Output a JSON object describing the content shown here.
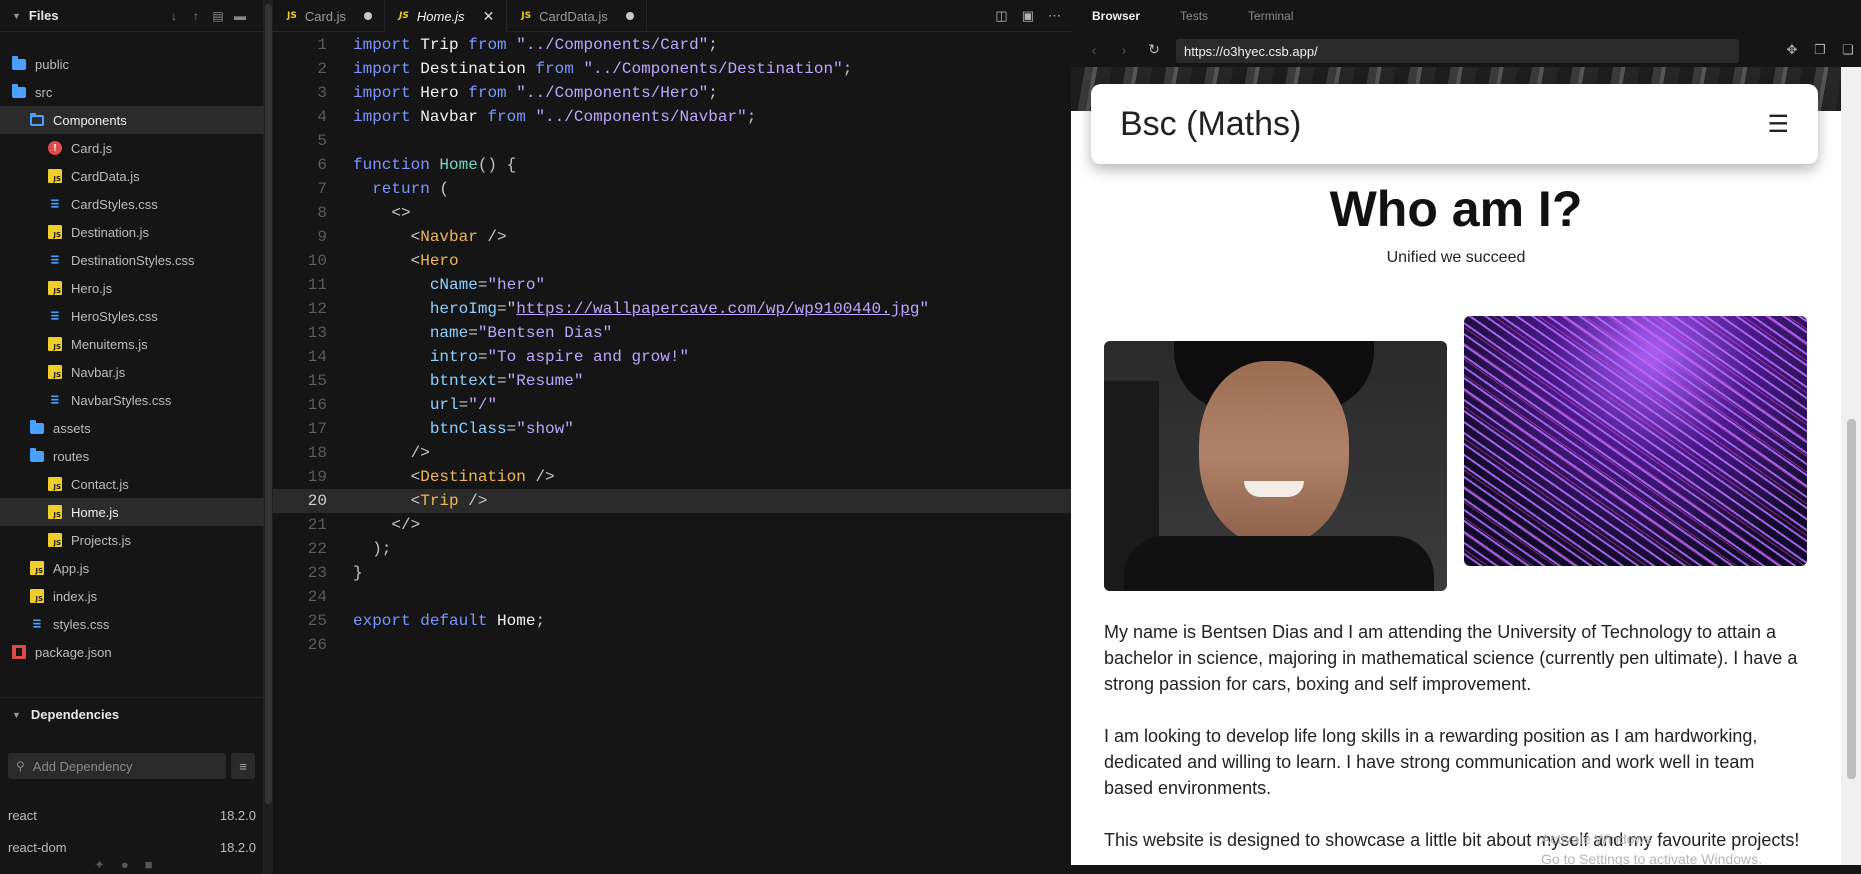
{
  "sidebar": {
    "title": "Files",
    "tree": [
      {
        "label": "public",
        "icon": "folder",
        "depth": 0
      },
      {
        "label": "src",
        "icon": "folder",
        "depth": 0
      },
      {
        "label": "Components",
        "icon": "folder-open",
        "depth": 1,
        "active": true
      },
      {
        "label": "Card.js",
        "icon": "error",
        "depth": 2
      },
      {
        "label": "CardData.js",
        "icon": "js",
        "depth": 2
      },
      {
        "label": "CardStyles.css",
        "icon": "css",
        "depth": 2
      },
      {
        "label": "Destination.js",
        "icon": "js",
        "depth": 2
      },
      {
        "label": "DestinationStyles.css",
        "icon": "css",
        "depth": 2
      },
      {
        "label": "Hero.js",
        "icon": "js",
        "depth": 2
      },
      {
        "label": "HeroStyles.css",
        "icon": "css",
        "depth": 2
      },
      {
        "label": "Menuitems.js",
        "icon": "js",
        "depth": 2
      },
      {
        "label": "Navbar.js",
        "icon": "js",
        "depth": 2
      },
      {
        "label": "NavbarStyles.css",
        "icon": "css",
        "depth": 2
      },
      {
        "label": "assets",
        "icon": "folder",
        "depth": 1
      },
      {
        "label": "routes",
        "icon": "folder",
        "depth": 1
      },
      {
        "label": "Contact.js",
        "icon": "js",
        "depth": 2
      },
      {
        "label": "Home.js",
        "icon": "js",
        "depth": 2,
        "active": true
      },
      {
        "label": "Projects.js",
        "icon": "js",
        "depth": 2
      },
      {
        "label": "App.js",
        "icon": "js",
        "depth": 1
      },
      {
        "label": "index.js",
        "icon": "js",
        "depth": 1
      },
      {
        "label": "styles.css",
        "icon": "css",
        "depth": 1
      },
      {
        "label": "package.json",
        "icon": "package",
        "depth": 0
      }
    ],
    "dependencies": {
      "title": "Dependencies",
      "placeholder": "Add Dependency",
      "items": [
        {
          "name": "react",
          "version": "18.2.0"
        },
        {
          "name": "react-dom",
          "version": "18.2.0"
        }
      ]
    }
  },
  "editor": {
    "tabs": [
      {
        "label": "Card.js",
        "badge": "JS",
        "state": "dot"
      },
      {
        "label": "Home.js",
        "badge": "JS",
        "state": "close",
        "active": true
      },
      {
        "label": "CardData.js",
        "badge": "JS",
        "state": "dot"
      }
    ],
    "current_line": 20,
    "lines": [
      [
        [
          "k",
          "import "
        ],
        [
          "id",
          "Trip "
        ],
        [
          "k",
          "from "
        ],
        [
          "s",
          "\"../Components/Card\""
        ],
        [
          "p",
          ";"
        ]
      ],
      [
        [
          "k",
          "import "
        ],
        [
          "id",
          "Destination "
        ],
        [
          "k",
          "from "
        ],
        [
          "s",
          "\"../Components/Destination\""
        ],
        [
          "p",
          ";"
        ]
      ],
      [
        [
          "k",
          "import "
        ],
        [
          "id",
          "Hero "
        ],
        [
          "k",
          "from "
        ],
        [
          "s",
          "\"../Components/Hero\""
        ],
        [
          "p",
          ";"
        ]
      ],
      [
        [
          "k",
          "import "
        ],
        [
          "id",
          "Navbar "
        ],
        [
          "k",
          "from "
        ],
        [
          "s",
          "\"../Components/Navbar\""
        ],
        [
          "p",
          ";"
        ]
      ],
      [],
      [
        [
          "k",
          "function "
        ],
        [
          "f",
          "Home"
        ],
        [
          "p",
          "() {"
        ]
      ],
      [
        [
          "p",
          "  "
        ],
        [
          "k",
          "return "
        ],
        [
          "p",
          "("
        ]
      ],
      [
        [
          "p",
          "    <>"
        ]
      ],
      [
        [
          "p",
          "      <"
        ],
        [
          "t",
          "Navbar"
        ],
        [
          "p",
          " />"
        ]
      ],
      [
        [
          "p",
          "      <"
        ],
        [
          "t",
          "Hero"
        ]
      ],
      [
        [
          "p",
          "        "
        ],
        [
          "a",
          "cName"
        ],
        [
          "p",
          "="
        ],
        [
          "s",
          "\"hero\""
        ]
      ],
      [
        [
          "p",
          "        "
        ],
        [
          "a",
          "heroImg"
        ],
        [
          "p",
          "=\""
        ],
        [
          "u",
          "https://wallpapercave.com/wp/wp9100440.jpg"
        ],
        [
          "s",
          "\""
        ]
      ],
      [
        [
          "p",
          "        "
        ],
        [
          "a",
          "name"
        ],
        [
          "p",
          "="
        ],
        [
          "s",
          "\"Bentsen Dias\""
        ]
      ],
      [
        [
          "p",
          "        "
        ],
        [
          "a",
          "intro"
        ],
        [
          "p",
          "="
        ],
        [
          "s",
          "\"To aspire and grow!\""
        ]
      ],
      [
        [
          "p",
          "        "
        ],
        [
          "a",
          "btntext"
        ],
        [
          "p",
          "="
        ],
        [
          "s",
          "\"Resume\""
        ]
      ],
      [
        [
          "p",
          "        "
        ],
        [
          "a",
          "url"
        ],
        [
          "p",
          "="
        ],
        [
          "s",
          "\"/\""
        ]
      ],
      [
        [
          "p",
          "        "
        ],
        [
          "a",
          "btnClass"
        ],
        [
          "p",
          "="
        ],
        [
          "s",
          "\"show\""
        ]
      ],
      [
        [
          "p",
          "      />"
        ]
      ],
      [
        [
          "p",
          "      <"
        ],
        [
          "t",
          "Destination"
        ],
        [
          "p",
          " />"
        ]
      ],
      [
        [
          "p",
          "      <"
        ],
        [
          "t",
          "Trip"
        ],
        [
          "p",
          " />"
        ]
      ],
      [
        [
          "p",
          "    </>"
        ]
      ],
      [
        [
          "p",
          "  );"
        ]
      ],
      [
        [
          "p",
          "}"
        ]
      ],
      [],
      [
        [
          "k",
          "export "
        ],
        [
          "k",
          "default "
        ],
        [
          "id",
          "Home"
        ],
        [
          "p",
          ";"
        ]
      ],
      []
    ]
  },
  "browser": {
    "tabs": [
      "Browser",
      "Tests",
      "Terminal"
    ],
    "url": "https://o3hyec.csb.app/",
    "page": {
      "brand": "Bsc (Maths)",
      "heading": "Who am I?",
      "subtitle": "Unified we succeed",
      "paragraphs": [
        "My name is Bentsen Dias and I am attending the University of Technology to attain a bachelor in science, majoring in mathematical science (currently pen ultimate). I have a strong passion for cars, boxing and self improvement.",
        "I am looking to develop life long skills in a rewarding position as I am hardworking, dedicated and willing to learn. I have strong communication and work well in team based environments.",
        "This website is designed to showcase a little bit about myself and my favourite projects!"
      ]
    },
    "watermark": [
      "Activate Windows",
      "Go to Settings to activate Windows."
    ]
  },
  "colors": {
    "accent": "#4aa0ff",
    "js_badge": "#f0cd2b",
    "keyword": "#7b96ff",
    "string": "#bda6ff",
    "tag": "#f0b65a"
  }
}
